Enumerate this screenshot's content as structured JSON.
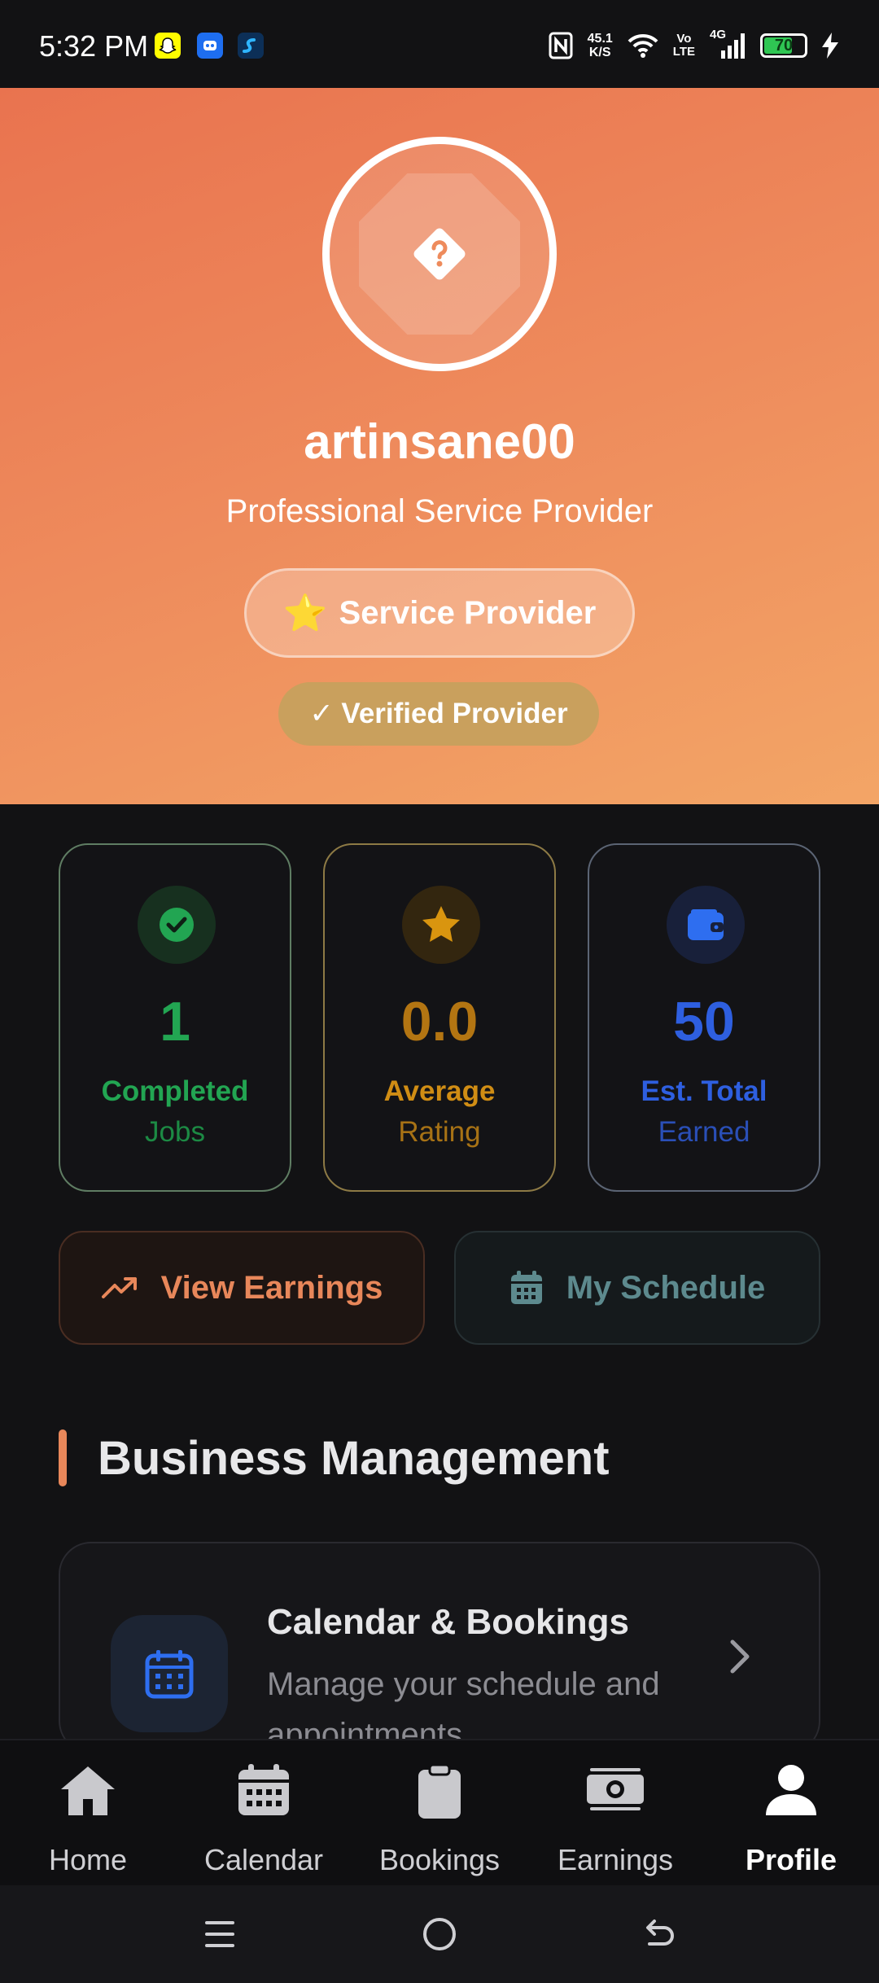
{
  "status_bar": {
    "time": "5:32 PM",
    "net_speed_value": "45.1",
    "net_speed_unit": "K/S",
    "volte_top": "Vo",
    "volte_bottom": "LTE",
    "network": "4G",
    "battery": "70",
    "icons": [
      "snapchat-icon",
      "app-icon",
      "shazam-icon",
      "nfc-icon",
      "wifi-icon",
      "signal-icon",
      "charging-icon"
    ]
  },
  "profile": {
    "username": "artinsane00",
    "role": "Professional Service Provider",
    "badge_emoji": "⭐",
    "badge_label": "Service Provider",
    "verified_label": "✓ Verified Provider",
    "avatar_icon": "question-diamond-icon"
  },
  "stats": [
    {
      "value": "1",
      "label_line1": "Completed",
      "label_line2": "Jobs",
      "icon": "check-circle-icon",
      "color": "#22a552"
    },
    {
      "value": "0.0",
      "label_line1": "Average",
      "label_line2": "Rating",
      "icon": "star-icon",
      "color": "#c78b12"
    },
    {
      "value": "50",
      "label_line1": "Est. Total",
      "label_line2": "Earned",
      "icon": "wallet-icon",
      "color": "#2e5fe0"
    }
  ],
  "actions": {
    "view_earnings": "View Earnings",
    "my_schedule": "My Schedule"
  },
  "section": {
    "title": "Business Management"
  },
  "management_items": [
    {
      "title": "Calendar & Bookings",
      "description": "Manage your schedule and appointments",
      "icon": "calendar-icon"
    }
  ],
  "bottom_nav": [
    {
      "label": "Home",
      "icon": "home-icon",
      "active": false
    },
    {
      "label": "Calendar",
      "icon": "calendar-icon",
      "active": false
    },
    {
      "label": "Bookings",
      "icon": "clipboard-icon",
      "active": false
    },
    {
      "label": "Earnings",
      "icon": "money-icon",
      "active": false
    },
    {
      "label": "Profile",
      "icon": "person-icon",
      "active": true
    }
  ],
  "colors": {
    "accent": "#e8875a",
    "background": "#121214",
    "hero_start": "#e9734f",
    "hero_end": "#f3a566"
  }
}
